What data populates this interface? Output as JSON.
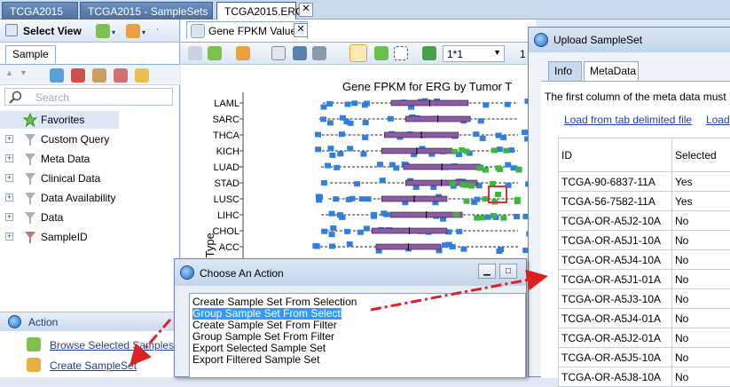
{
  "doc_tabs": [
    {
      "label": "TCGA2015"
    },
    {
      "label": "TCGA2015 - SampleSets"
    },
    {
      "label": "TCGA2015.ERG"
    }
  ],
  "left_panel": {
    "header_title": "Select View",
    "tab_label": "Sample",
    "search_placeholder": "Search",
    "tree": [
      {
        "label": "Favorites",
        "icon": "star-icon"
      },
      {
        "label": "Custom Query",
        "icon": "filter-icon"
      },
      {
        "label": "Meta Data",
        "icon": "filter-icon"
      },
      {
        "label": "Clinical Data",
        "icon": "filter-icon"
      },
      {
        "label": "Data Availability",
        "icon": "filter-icon"
      },
      {
        "label": "Data",
        "icon": "filter-icon"
      },
      {
        "label": "SampleID",
        "icon": "filter-icon"
      }
    ],
    "action_header": "Action",
    "actions": [
      {
        "label": "Browse Selected Samples"
      },
      {
        "label": "Create SampleSet"
      }
    ]
  },
  "main_panel": {
    "tab_label": "Gene FPKM Values",
    "zoom_value": "1*1",
    "page_indicator": "1"
  },
  "chart_data": {
    "type": "box",
    "title": "Gene FPKM for ERG by Tumor T",
    "ylabel": "Tumor Type",
    "categories": [
      "LAML",
      "SARC",
      "THCA",
      "KICH",
      "LUAD",
      "STAD",
      "LUSC",
      "LIHC",
      "CHOL",
      "ACC"
    ],
    "accent_colors": {
      "points": "#2e7fe0",
      "box": "#8e5aa8",
      "selected_points": "#3cb83c",
      "highlight": "#e03030"
    }
  },
  "upload_dialog": {
    "title": "Upload SampleSet",
    "tabs": [
      {
        "label": "Info"
      },
      {
        "label": "MetaData"
      }
    ],
    "note": "The first column of the meta data must b",
    "links": [
      {
        "label": "Load from tab delimited file"
      },
      {
        "label": "Load"
      }
    ],
    "columns": [
      "ID",
      "Selected"
    ],
    "rows": [
      [
        "TCGA-90-6837-11A",
        "Yes"
      ],
      [
        "TCGA-56-7582-11A",
        "Yes"
      ],
      [
        "TCGA-OR-A5J2-10A",
        "No"
      ],
      [
        "TCGA-OR-A5J1-10A",
        "No"
      ],
      [
        "TCGA-OR-A5J4-10A",
        "No"
      ],
      [
        "TCGA-OR-A5J1-01A",
        "No"
      ],
      [
        "TCGA-OR-A5J3-10A",
        "No"
      ],
      [
        "TCGA-OR-A5J4-01A",
        "No"
      ],
      [
        "TCGA-OR-A5J2-01A",
        "No"
      ],
      [
        "TCGA-OR-A5J5-10A",
        "No"
      ],
      [
        "TCGA-OR-A5J8-10A",
        "No"
      ]
    ]
  },
  "choose_dialog": {
    "title": "Choose An Action",
    "options": [
      {
        "label": "Create Sample Set From Selection",
        "selected": false
      },
      {
        "label": "Group Sample Set From Selection",
        "selected": true
      },
      {
        "label": "Create Sample Set From Filter",
        "selected": false
      },
      {
        "label": "Group Sample Set From Filter",
        "selected": false
      },
      {
        "label": "Export Selected Sample Set",
        "selected": false
      },
      {
        "label": "Export Filtered Sample Set",
        "selected": false
      }
    ]
  },
  "annotation_color": "#e02020"
}
